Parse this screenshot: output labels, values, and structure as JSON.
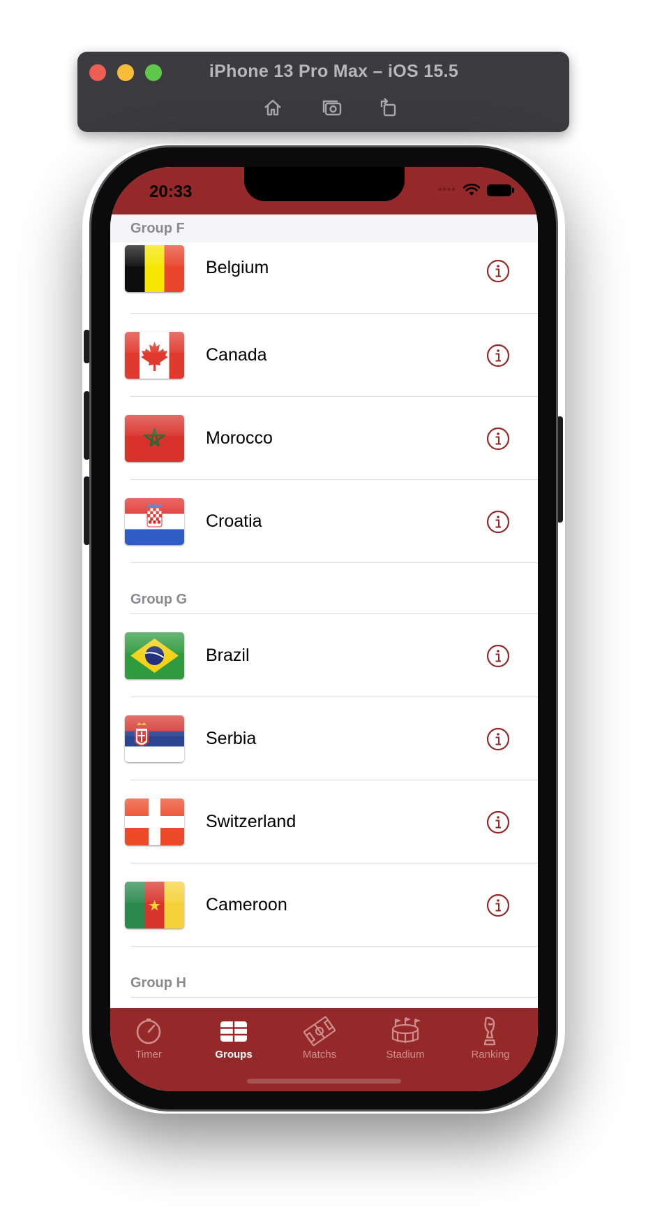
{
  "simulator": {
    "title": "iPhone 13 Pro Max – iOS 15.5",
    "buttons": [
      "home-icon",
      "screenshot-icon",
      "rotate-icon"
    ]
  },
  "status_bar": {
    "time": "20:33",
    "icons": [
      "cellular-dots-icon",
      "wifi-icon",
      "battery-icon"
    ]
  },
  "colors": {
    "accent": "#952828",
    "tab_inactive": "#cf8e8e",
    "header_text": "#8a8a8e"
  },
  "groups": [
    {
      "label": "Group F",
      "teams": [
        {
          "name": "Belgium",
          "flag": "belgium-flag"
        },
        {
          "name": "Canada",
          "flag": "canada-flag"
        },
        {
          "name": "Morocco",
          "flag": "morocco-flag"
        },
        {
          "name": "Croatia",
          "flag": "croatia-flag"
        }
      ]
    },
    {
      "label": "Group G",
      "teams": [
        {
          "name": "Brazil",
          "flag": "brazil-flag"
        },
        {
          "name": "Serbia",
          "flag": "serbia-flag"
        },
        {
          "name": "Switzerland",
          "flag": "switzerland-flag"
        },
        {
          "name": "Cameroon",
          "flag": "cameroon-flag"
        }
      ]
    },
    {
      "label": "Group H",
      "teams": []
    }
  ],
  "tabs": [
    {
      "label": "Timer",
      "icon": "timer-icon",
      "active": false
    },
    {
      "label": "Groups",
      "icon": "groups-table-icon",
      "active": true
    },
    {
      "label": "Matchs",
      "icon": "soccer-field-icon",
      "active": false
    },
    {
      "label": "Stadium",
      "icon": "stadium-icon",
      "active": false
    },
    {
      "label": "Ranking",
      "icon": "trophy-icon",
      "active": false
    }
  ]
}
